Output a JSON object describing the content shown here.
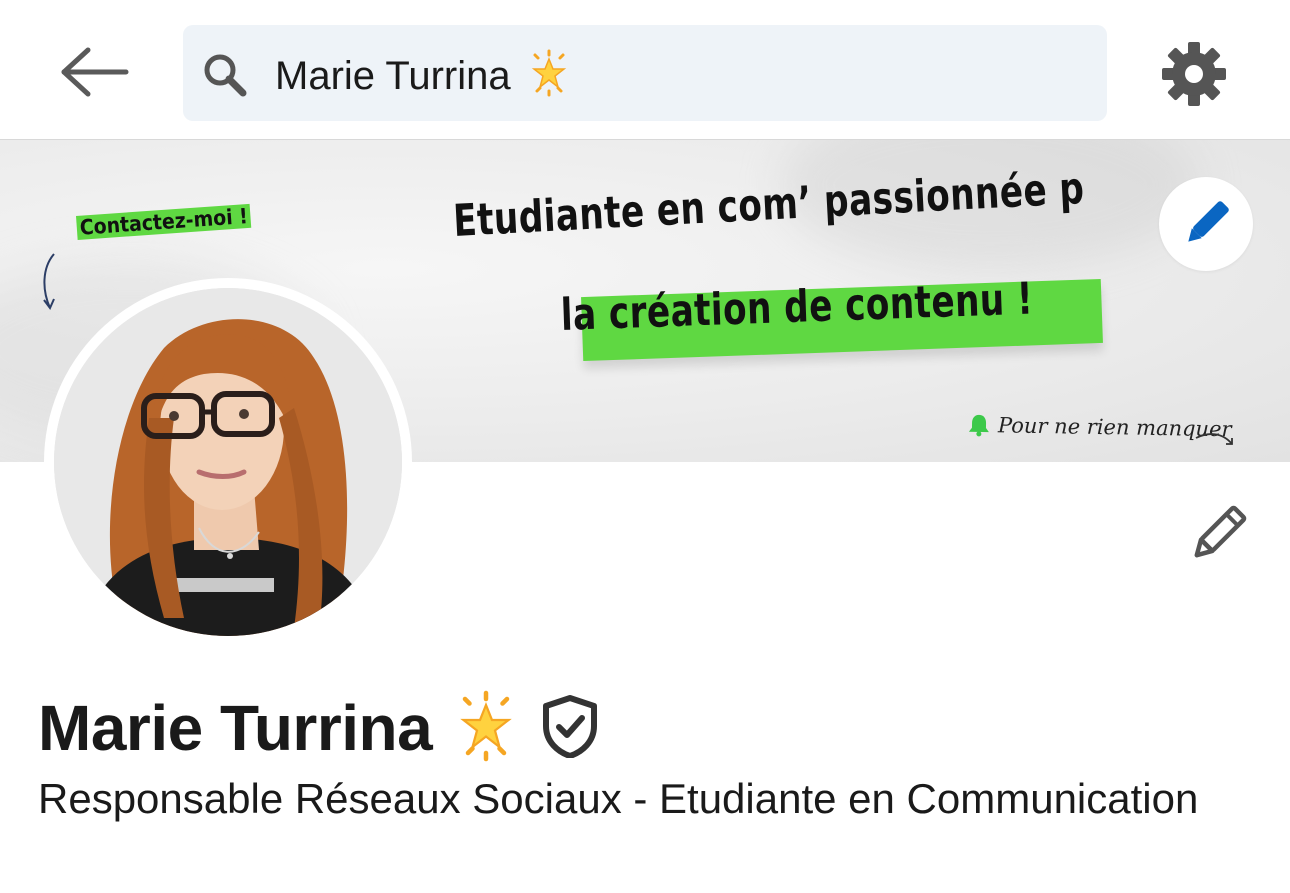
{
  "search": {
    "query": "Marie Turrina",
    "icon": "search-icon"
  },
  "topbar": {
    "back_icon": "arrow-left-icon",
    "settings_icon": "gear-icon"
  },
  "banner": {
    "contact_label": "Contactez-moi !",
    "headline_line1": "Etudiante en com’ passionnée p",
    "headline_line2": "la création de contenu !",
    "notify_label": "Pour ne rien manquer",
    "highlight_color": "#5fd842",
    "edit_icon": "pencil-icon"
  },
  "profile": {
    "name": "Marie Turrina",
    "headline": "Responsable Réseaux Sociaux - Etudiante en Communication",
    "edit_icon": "pencil-icon",
    "verified_icon": "verified-shield-icon"
  },
  "colors": {
    "accent_blue": "#0a66c2",
    "icon_gray": "#555555"
  }
}
